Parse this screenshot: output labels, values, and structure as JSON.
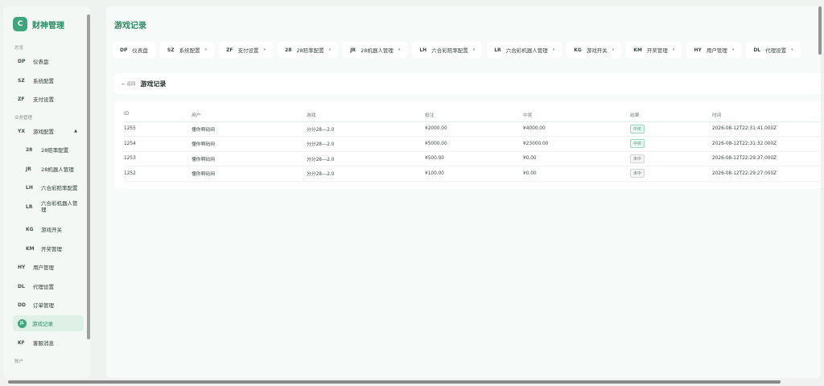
{
  "brand": {
    "logo": "C",
    "name": "财神管理"
  },
  "sidebar": {
    "section_main": "总览",
    "section_biz": "业务管理",
    "section_account": "账户",
    "items": [
      {
        "code": "DP",
        "label": "仪表盘"
      },
      {
        "code": "SZ",
        "label": "系统配置"
      },
      {
        "code": "ZF",
        "label": "支付设置"
      },
      {
        "code": "YX",
        "label": "游戏配置",
        "caret": "▲"
      },
      {
        "code": "28",
        "label": "28赔率配置"
      },
      {
        "code": "JR",
        "label": "28机器人管理"
      },
      {
        "code": "LH",
        "label": "六合彩赔率配置"
      },
      {
        "code": "LR",
        "label": "六合彩机器人管理"
      },
      {
        "code": "KG",
        "label": "游戏开关"
      },
      {
        "code": "KM",
        "label": "开奖管理"
      },
      {
        "code": "HY",
        "label": "用户管理"
      },
      {
        "code": "DL",
        "label": "代理设置"
      },
      {
        "code": "DD",
        "label": "订单管理"
      },
      {
        "code": "JL",
        "label": "游戏记录"
      },
      {
        "code": "KF",
        "label": "客服消息"
      }
    ]
  },
  "page_title": "游戏记录",
  "tabs": [
    {
      "code": "DP",
      "label": "仪表盘",
      "chev": ""
    },
    {
      "code": "SZ",
      "label": "系统配置",
      "chev": "▾"
    },
    {
      "code": "ZF",
      "label": "支付设置",
      "chev": "▾"
    },
    {
      "code": "28",
      "label": "28赔率配置",
      "chev": "▾"
    },
    {
      "code": "JR",
      "label": "28机器人管理",
      "chev": "▾"
    },
    {
      "code": "LH",
      "label": "六合彩赔率配置",
      "chev": "▾"
    },
    {
      "code": "LR",
      "label": "六合彩机器人管理",
      "chev": "▾"
    },
    {
      "code": "KG",
      "label": "游戏开关",
      "chev": "▾"
    },
    {
      "code": "KM",
      "label": "开奖管理",
      "chev": "▾"
    },
    {
      "code": "HY",
      "label": "用户管理",
      "chev": "▾"
    },
    {
      "code": "DL",
      "label": "代理设置",
      "chev": "▾"
    }
  ],
  "card": {
    "back": "← 返回",
    "title": "游戏记录"
  },
  "table": {
    "headers": [
      "ID",
      "用户",
      "游戏",
      "投注",
      "中奖",
      "结果",
      "时间"
    ],
    "rows": [
      [
        "1255",
        "懂你啊码网",
        "分分28---2.0",
        "¥2000.00",
        "¥4000.00",
        "中奖",
        "2026-08-12T22:31:41.000Z"
      ],
      [
        "1254",
        "懂你啊码网",
        "分分28---2.0",
        "¥5000.00",
        "¥23000.00",
        "中奖",
        "2026-08-12T22:31:32.000Z"
      ],
      [
        "1253",
        "懂你啊码网",
        "分分28---2.0",
        "¥500.00",
        "¥0.00",
        "未中",
        "2026-08-12T22:29:37.000Z"
      ],
      [
        "1252",
        "懂你啊码网",
        "分分28---2.0",
        "¥100.00",
        "¥0.00",
        "未中",
        "2026-08-12T22:29:27.000Z"
      ]
    ],
    "result_types": [
      "win",
      "win",
      "lose",
      "lose"
    ]
  },
  "colors": {
    "accent": "#3fa57c",
    "accent_dark": "#2b8a63",
    "bg": "#eef3f0"
  }
}
